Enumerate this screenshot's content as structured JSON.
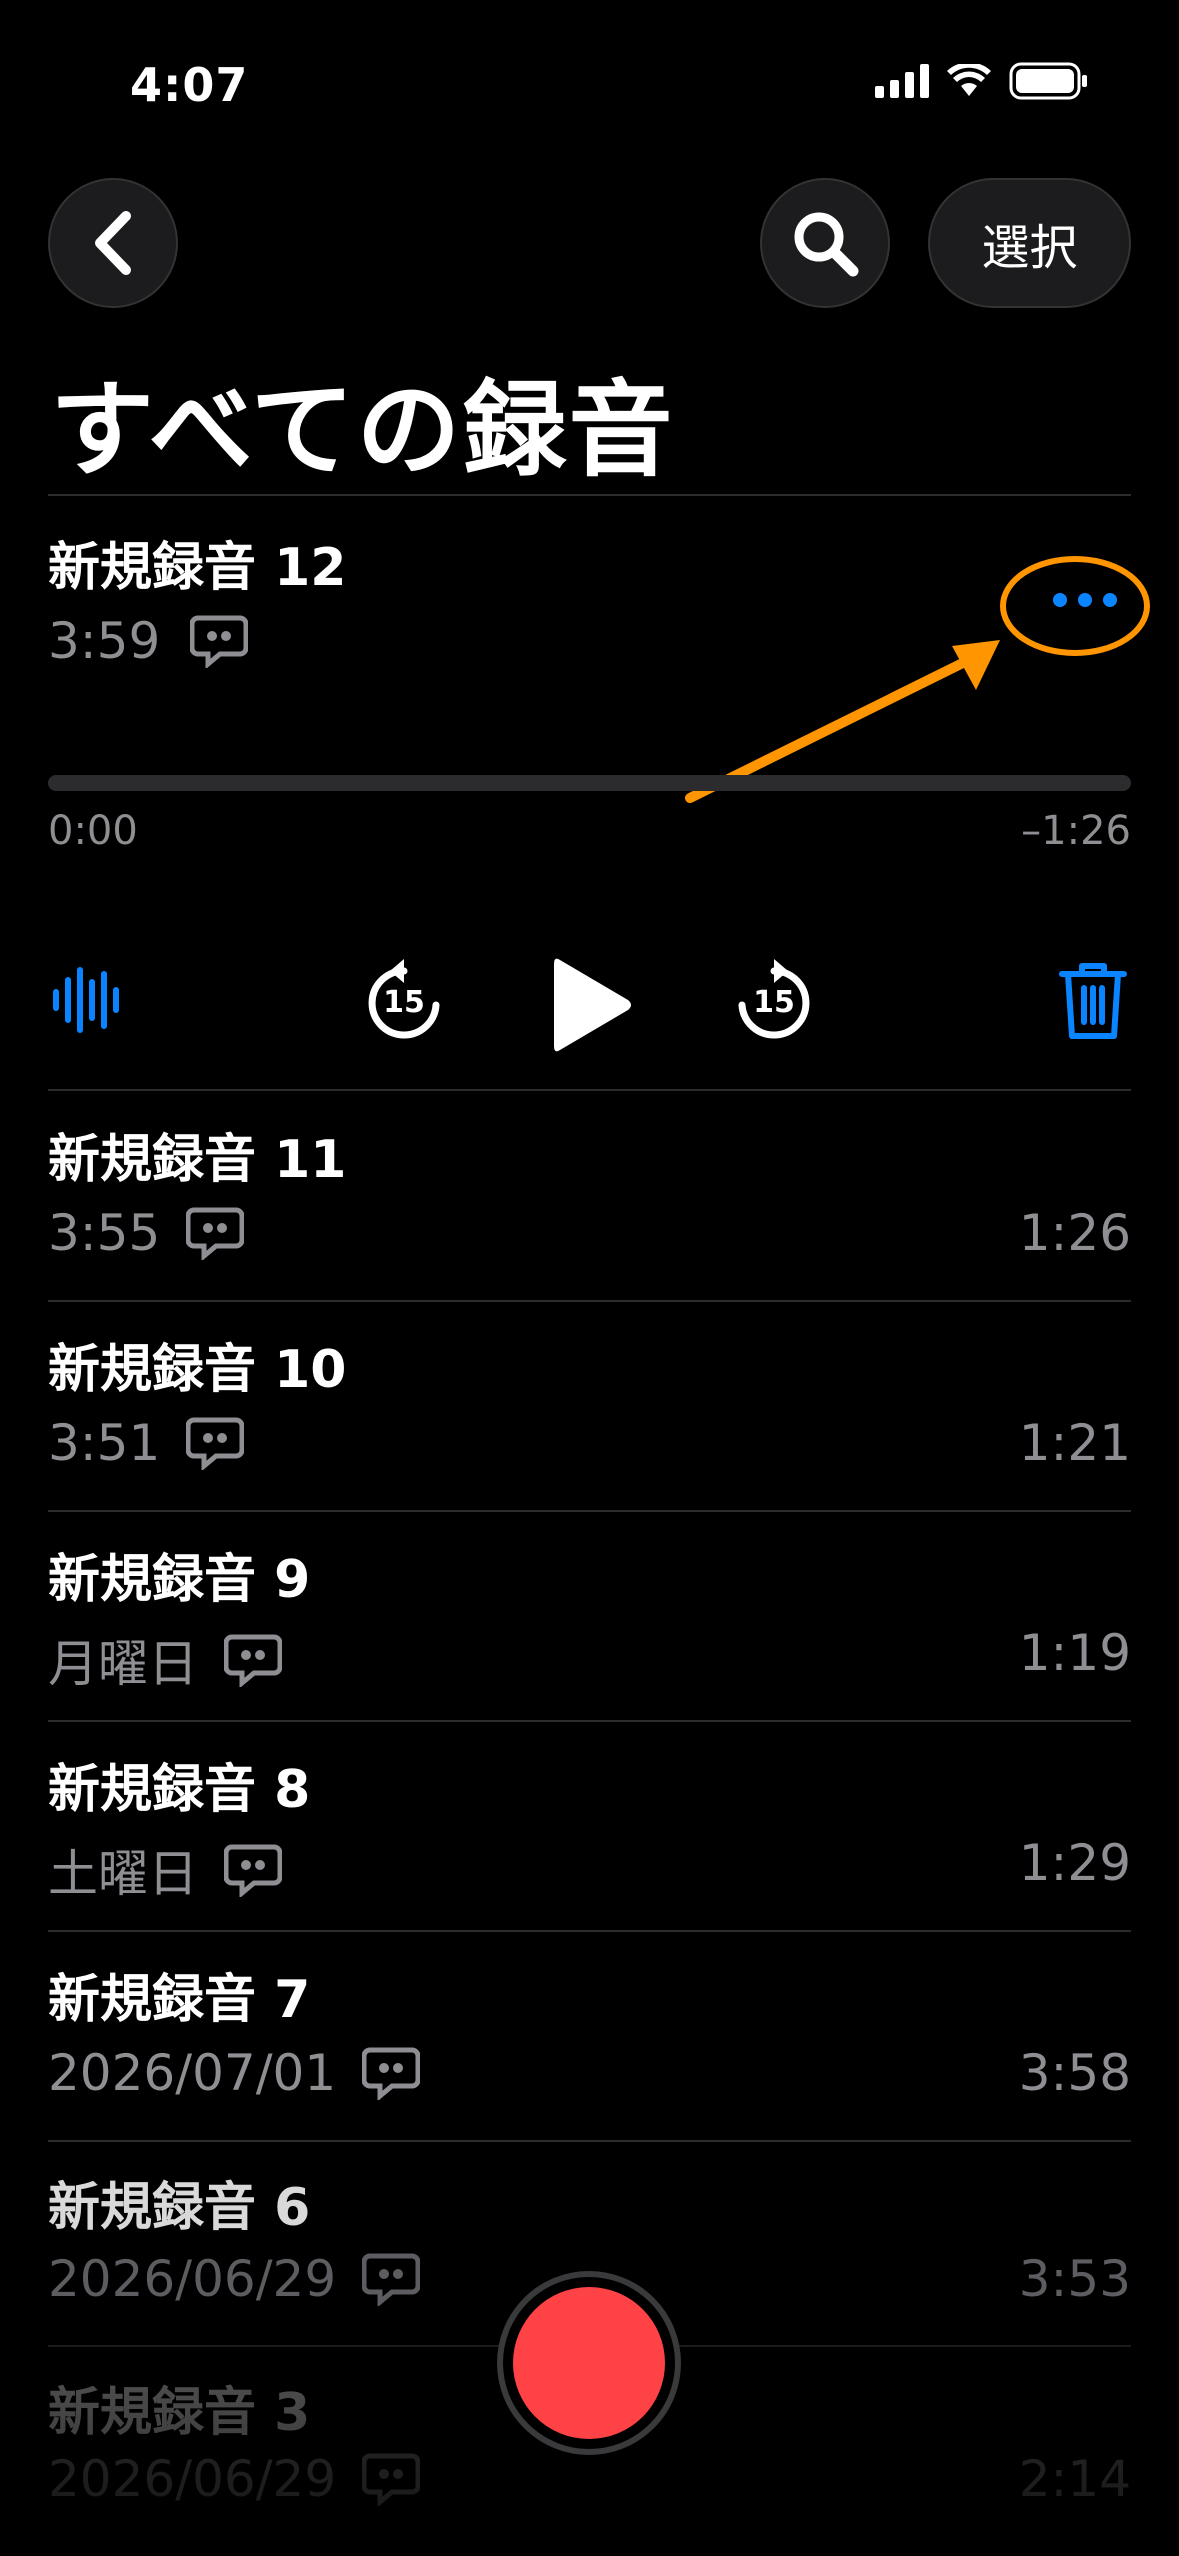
{
  "status_bar": {
    "time": "4:07"
  },
  "nav": {
    "select_label": "選択"
  },
  "page": {
    "title": "すべての録音"
  },
  "expanded": {
    "title": "新規録音 12",
    "time": "3:59",
    "elapsed": "0:00",
    "remaining": "–1:26",
    "progress": 0,
    "skip_seconds": "15"
  },
  "recordings": [
    {
      "title": "新規録音 11",
      "date": "3:55",
      "duration": "1:26"
    },
    {
      "title": "新規録音 10",
      "date": "3:51",
      "duration": "1:21"
    },
    {
      "title": "新規録音 9",
      "date": "月曜日",
      "duration": "1:19"
    },
    {
      "title": "新規録音 8",
      "date": "土曜日",
      "duration": "1:29"
    },
    {
      "title": "新規録音 7",
      "date": "2026/07/01",
      "duration": "3:58"
    },
    {
      "title": "新規録音 6",
      "date": "2026/06/29",
      "duration": "3:53"
    },
    {
      "title": "新規録音 3",
      "date": "2026/06/29",
      "duration": "2:14"
    }
  ],
  "colors": {
    "accent": "#0a84ff",
    "record": "#ff4245",
    "annotation": "#ff9500",
    "secondary_text": "#8e8e93"
  }
}
